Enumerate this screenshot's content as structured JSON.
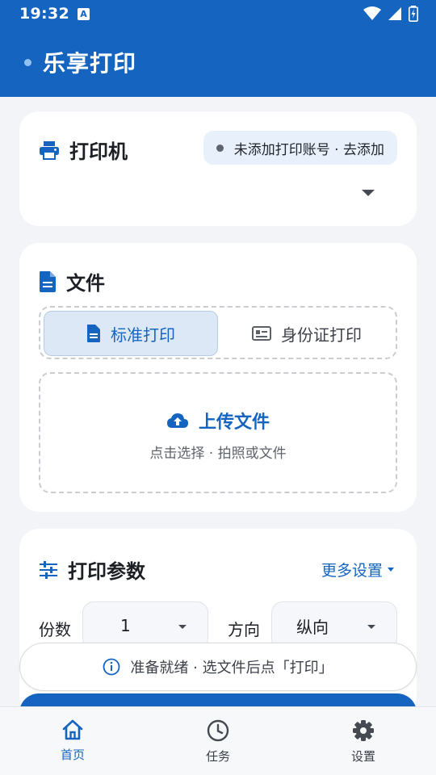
{
  "status_bar": {
    "time": "19:32",
    "notif_letter": "A"
  },
  "app_bar": {
    "title": "乐享打印"
  },
  "printer_card": {
    "title": "打印机",
    "account_status": "未添加打印账号 · 去添加",
    "icon": "printer-icon"
  },
  "file_card": {
    "title": "文件",
    "icon": "document-icon",
    "modes": [
      {
        "label": "标准打印",
        "icon": "document-icon",
        "selected": true
      },
      {
        "label": "身份证打印",
        "icon": "id-card-icon",
        "selected": false
      }
    ],
    "upload": {
      "title": "上传文件",
      "subtitle": "点击选择 · 拍照或文件",
      "icon": "cloud-upload-icon"
    }
  },
  "params_card": {
    "title": "打印参数",
    "icon": "sliders-icon",
    "more_label": "更多设置",
    "copies_label": "份数",
    "copies_value": "1",
    "orientation_label": "方向",
    "orientation_value": "纵向"
  },
  "status_message": "准备就绪 · 选文件后点「打印」",
  "bottom_nav": [
    {
      "label": "首页",
      "icon": "home-icon",
      "active": true
    },
    {
      "label": "任务",
      "icon": "clock-icon",
      "active": false
    },
    {
      "label": "设置",
      "icon": "gear-icon",
      "active": false
    }
  ],
  "colors": {
    "primary": "#1565c0",
    "background": "#f2f4f8",
    "pill": "#e8f0fb"
  }
}
